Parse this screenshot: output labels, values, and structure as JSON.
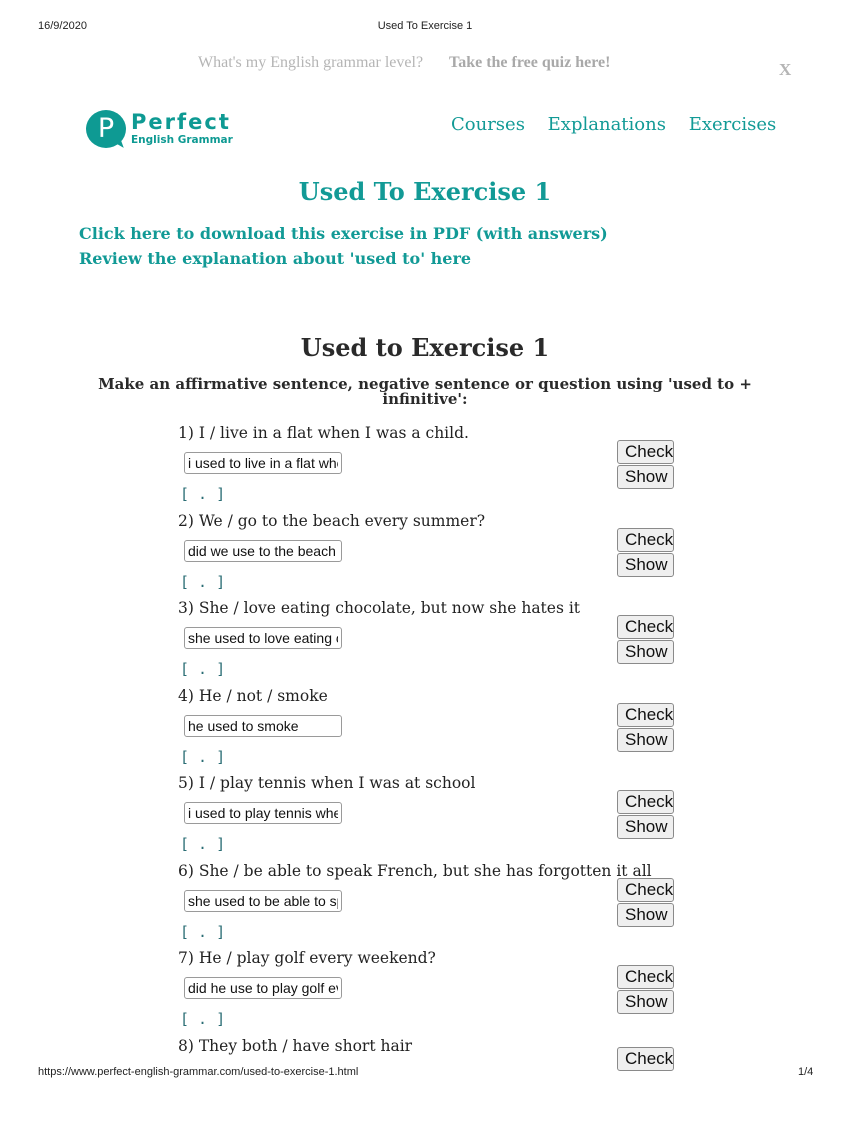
{
  "print_header": {
    "date": "16/9/2020",
    "title": "Used To Exercise 1"
  },
  "promo": {
    "question": "What's my English grammar level?",
    "link": "Take the free quiz here!",
    "close": "X"
  },
  "logo": {
    "letter": "P",
    "word": "Perfect",
    "subtitle": "English Grammar"
  },
  "nav": {
    "items": [
      {
        "label": "Courses"
      },
      {
        "label": "Explanations"
      },
      {
        "label": "Exercises"
      }
    ]
  },
  "page": {
    "title": "Used To Exercise 1",
    "links": [
      {
        "label": "Click here to download this exercise in PDF (with answers)"
      },
      {
        "label": "Review the explanation about 'used to' here"
      }
    ]
  },
  "exercise": {
    "title": "Used to Exercise 1",
    "instructions": "Make an affirmative sentence, negative sentence or question using 'used to + infinitive':",
    "check_label": "Check",
    "show_label": "Show",
    "feedback": "[ . ]",
    "questions": [
      {
        "text": "1) I / live in a flat when I was a child.",
        "answer": "i used to live in a flat when I was a child"
      },
      {
        "text": "2) We / go to the beach every summer?",
        "answer": "did we use to the beach"
      },
      {
        "text": "3) She / love eating chocolate, but now she hates it",
        "answer": "she used to love eating chocolate"
      },
      {
        "text": "4) He / not / smoke",
        "answer": "he used to smoke"
      },
      {
        "text": "5) I / play tennis when I was at school",
        "answer": "i used to play tennis when I was at school"
      },
      {
        "text": "6) She / be able to speak French, but she has forgotten it all",
        "answer": "she used to be able to speak French"
      },
      {
        "text": "7) He / play golf every weekend?",
        "answer": "did he use to play golf every weekend"
      },
      {
        "text": "8) They both / have short hair",
        "answer": ""
      }
    ]
  },
  "print_footer": {
    "url": "https://www.perfect-english-grammar.com/used-to-exercise-1.html",
    "page": "1/4"
  },
  "colors": {
    "brand": "#129a96",
    "promo_text": "#b5b5b5",
    "feedback": "#2a6d74"
  }
}
